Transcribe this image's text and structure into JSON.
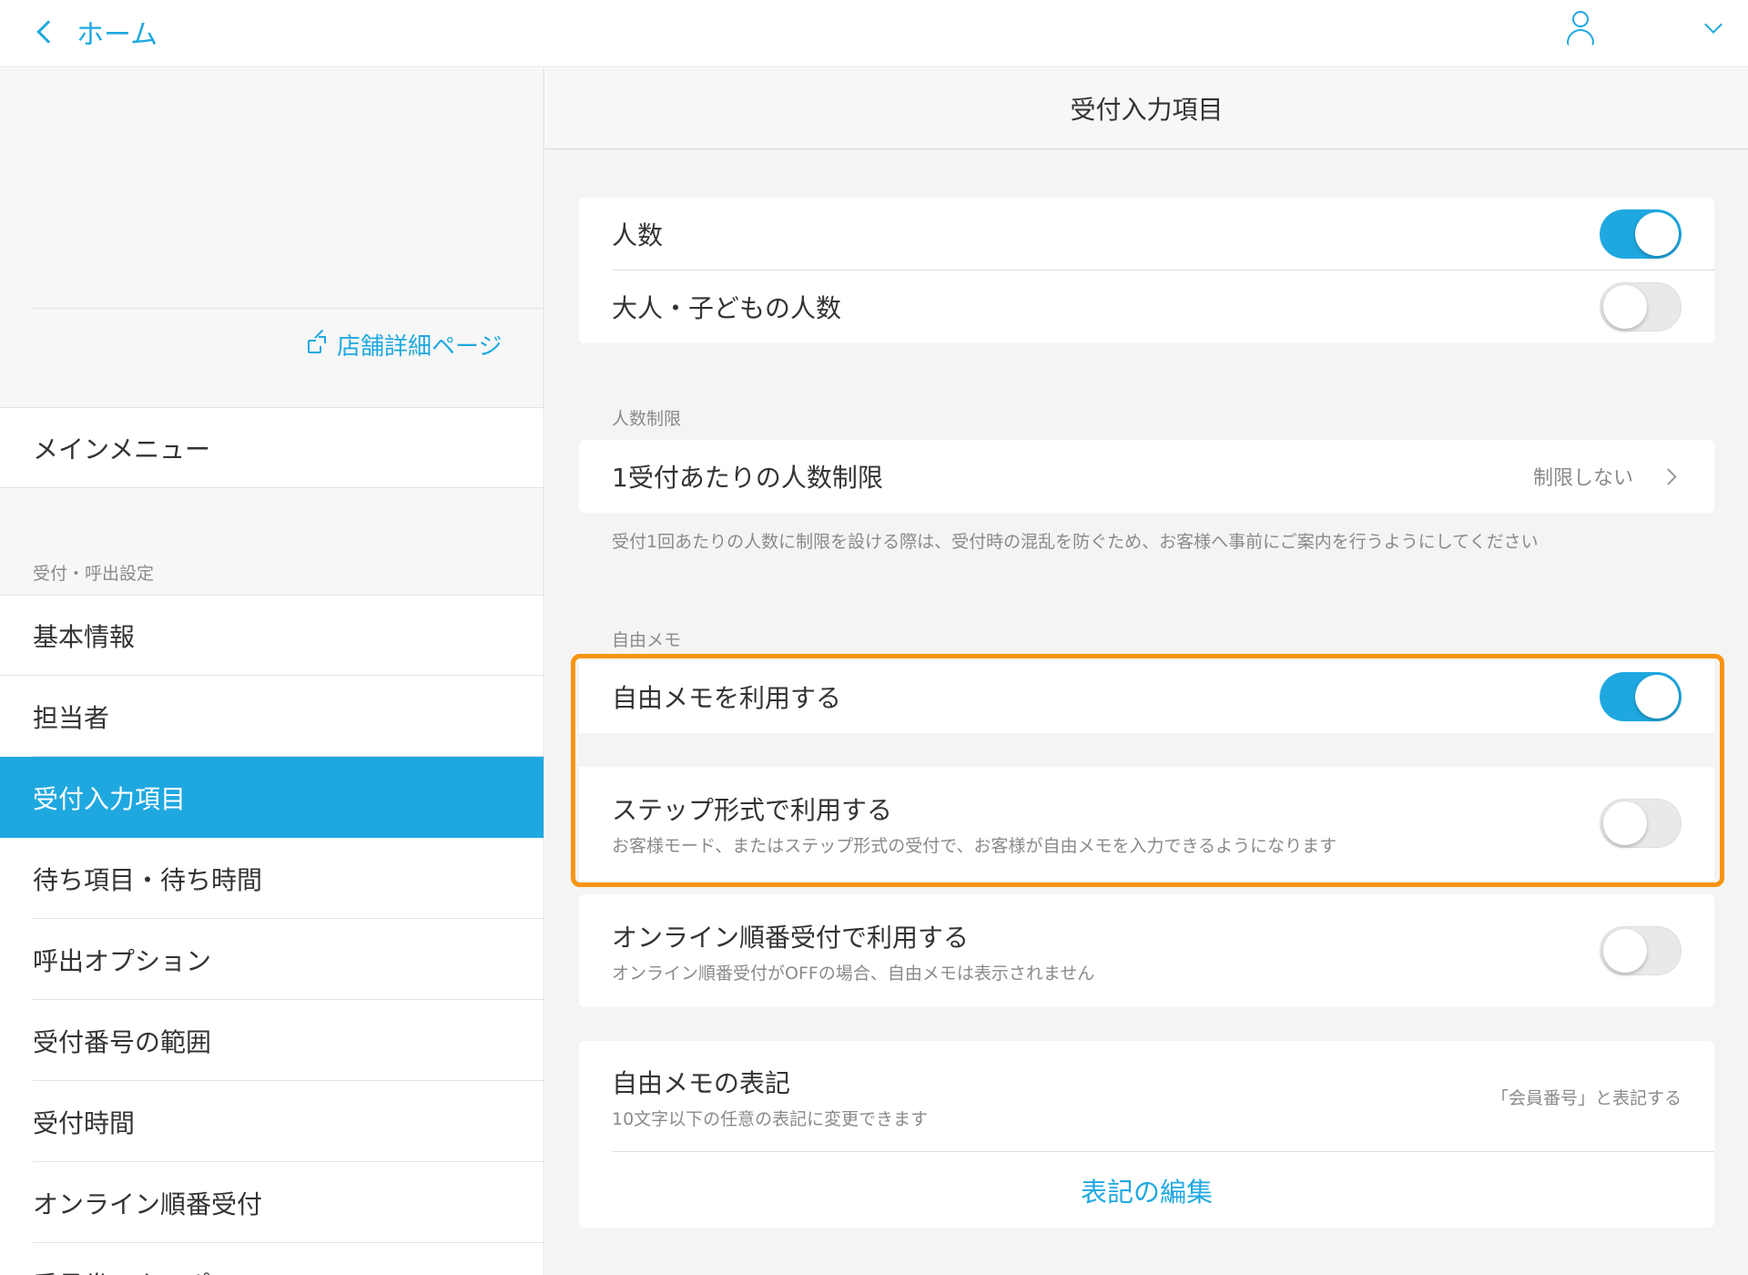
{
  "topbar": {
    "back_label": "ホーム",
    "accent_color": "#1fa8e0"
  },
  "sidebar": {
    "store_link": "店舗詳細ページ",
    "main_menu": "メインメニュー",
    "section_label": "受付・呼出設定",
    "items": [
      {
        "label": "基本情報"
      },
      {
        "label": "担当者"
      },
      {
        "label": "受付入力項目",
        "active": true
      },
      {
        "label": "待ち項目・待ち時間"
      },
      {
        "label": "呼出オプション"
      },
      {
        "label": "受付番号の範囲"
      },
      {
        "label": "受付時間"
      },
      {
        "label": "オンライン順番受付"
      },
      {
        "label": "番号券・クーポン"
      }
    ]
  },
  "main": {
    "title": "受付入力項目",
    "people": {
      "count_label": "人数",
      "count_enabled": true,
      "adult_child_label": "大人・子どもの人数",
      "adult_child_enabled": false
    },
    "limit": {
      "section_label": "人数制限",
      "row_label": "1受付あたりの人数制限",
      "row_value": "制限しない",
      "note": "受付1回あたりの人数に制限を設ける際は、受付時の混乱を防ぐため、お客様へ事前にご案内を行うようにしてください"
    },
    "memo": {
      "section_label": "自由メモ",
      "use_label": "自由メモを利用する",
      "use_enabled": true,
      "step_label": "ステップ形式で利用する",
      "step_note": "お客様モード、またはステップ形式の受付で、お客様が自由メモを入力できるようになります",
      "step_enabled": false,
      "online_label": "オンライン順番受付で利用する",
      "online_note": "オンライン順番受付がOFFの場合、自由メモは表示されません",
      "online_enabled": false
    },
    "notation": {
      "label": "自由メモの表記",
      "note": "10文字以下の任意の表記に変更できます",
      "value": "「会員番号」と表記する",
      "edit_label": "表記の編集"
    },
    "highlight_color": "#f7940f"
  }
}
